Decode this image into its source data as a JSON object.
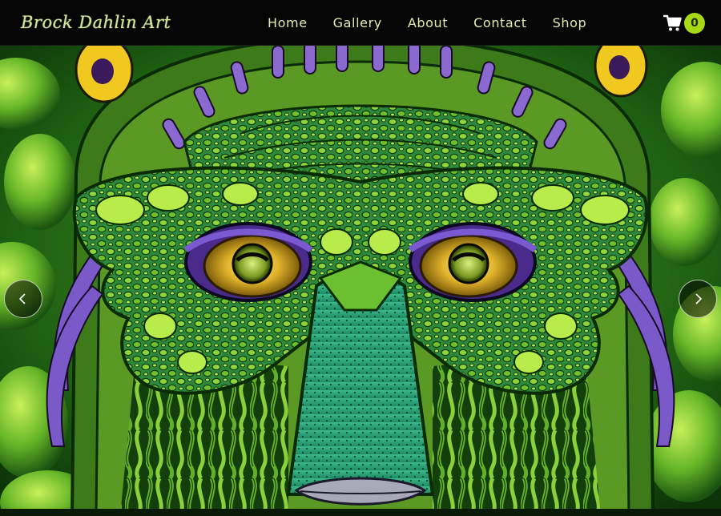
{
  "brand": {
    "logo_text": "Brock Dahlin Art",
    "accent_color": "#a8d916",
    "nav_text_color": "#e4eab0"
  },
  "nav": {
    "items": [
      {
        "label": "Home"
      },
      {
        "label": "Gallery"
      },
      {
        "label": "About"
      },
      {
        "label": "Contact"
      },
      {
        "label": "Shop"
      }
    ]
  },
  "cart": {
    "icon": "shopping-cart-icon",
    "count": "0"
  },
  "hero": {
    "image_subject": "green reptilian creature face artwork",
    "prev_icon": "chevron-left-icon",
    "next_icon": "chevron-right-icon"
  }
}
